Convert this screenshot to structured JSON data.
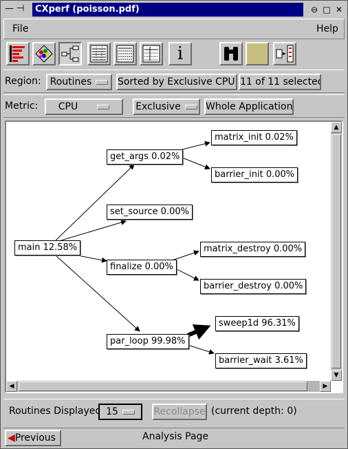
{
  "window": {
    "title": "CXperf (poisson.pdf)"
  },
  "menubar": {
    "file": "File",
    "help": "Help"
  },
  "toolbar": {
    "tools": [
      "bar-chart-icon",
      "scatter-icon",
      "call-graph-icon",
      "table-icon",
      "table-list-icon",
      "table-grid-icon",
      "info-icon",
      "binoculars-icon",
      "blank-icon",
      "flow-icon"
    ],
    "info_glyph": "i"
  },
  "region": {
    "label": "Region:",
    "routines": "Routines",
    "sort": "Sorted by Exclusive CPU...",
    "selected": "11 of 11 selected"
  },
  "metric": {
    "label": "Metric:",
    "cpu": "CPU",
    "exclusive": "Exclusive",
    "scope": "Whole Application"
  },
  "graph": {
    "nodes": [
      {
        "id": "main",
        "label": "main  12.58%"
      },
      {
        "id": "get_args",
        "label": "get_args  0.02%"
      },
      {
        "id": "matrix_init",
        "label": "matrix_init  0.02%"
      },
      {
        "id": "barrier_init",
        "label": "barrier_init  0.00%"
      },
      {
        "id": "set_source",
        "label": "set_source  0.00%"
      },
      {
        "id": "finalize",
        "label": "finalize  0.00%"
      },
      {
        "id": "matrix_destroy",
        "label": "matrix_destroy  0.00%"
      },
      {
        "id": "barrier_destroy",
        "label": "barrier_destroy  0.00%"
      },
      {
        "id": "par_loop",
        "label": "par_loop  99.98%"
      },
      {
        "id": "sweep1d",
        "label": "sweep1d  96.31%"
      },
      {
        "id": "barrier_wait",
        "label": "barrier_wait  3.61%"
      }
    ]
  },
  "footer": {
    "routines_label": "Routines Displayed",
    "routines_value": "15",
    "recollapse": "Recollapse",
    "depth": "(current depth: 0)"
  },
  "status": {
    "previous": "Previous",
    "page": "Analysis Page"
  },
  "colors": {
    "title_bg": "#000084",
    "accent": "#cc0000"
  }
}
